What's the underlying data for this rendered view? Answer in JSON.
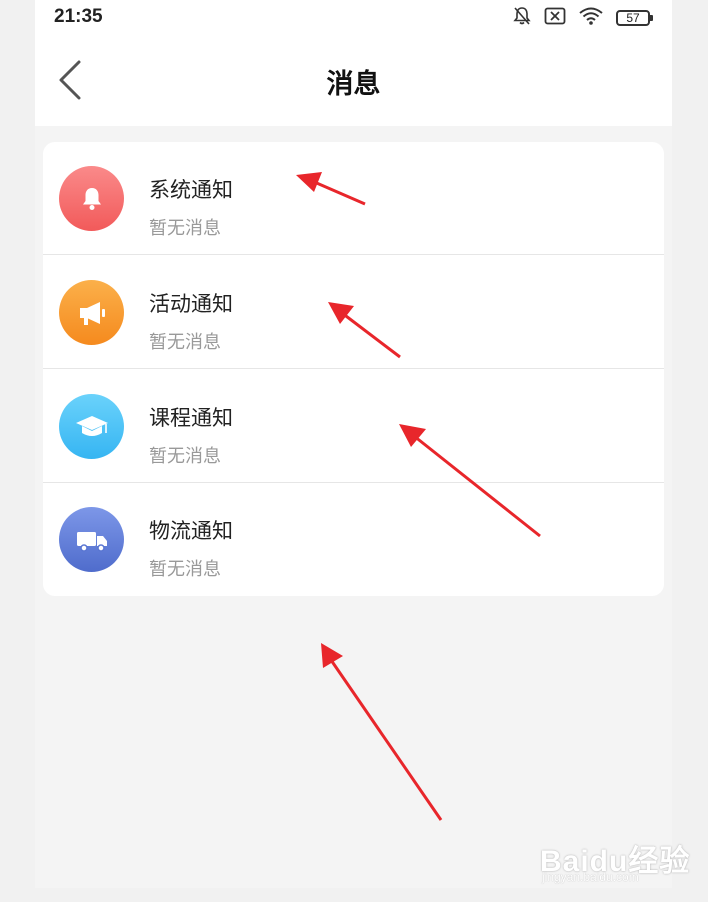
{
  "status_bar": {
    "time": "21:35",
    "battery": "57",
    "icons": [
      "bell-off-icon",
      "sim-off-icon",
      "wifi-icon",
      "battery-icon"
    ]
  },
  "nav": {
    "title": "消息",
    "back_icon": "chevron-left-icon"
  },
  "notifications": [
    {
      "title": "系统通知",
      "subtitle": "暂无消息",
      "icon": "bell-icon",
      "color_top": "#fa8a8a",
      "color_bottom": "#f25a5a"
    },
    {
      "title": "活动通知",
      "subtitle": "暂无消息",
      "icon": "megaphone-icon",
      "color_top": "#fbb04a",
      "color_bottom": "#f58a1e"
    },
    {
      "title": "课程通知",
      "subtitle": "暂无消息",
      "icon": "graduation-cap-icon",
      "color_top": "#6ad2fb",
      "color_bottom": "#36b5f2"
    },
    {
      "title": "物流通知",
      "subtitle": "暂无消息",
      "icon": "truck-icon",
      "color_top": "#7d97e8",
      "color_bottom": "#4f6ccc"
    }
  ],
  "watermark": {
    "logo": "Baidu经验",
    "url": "jingyan.baidu.com"
  },
  "annotation_color": "#e8262b"
}
